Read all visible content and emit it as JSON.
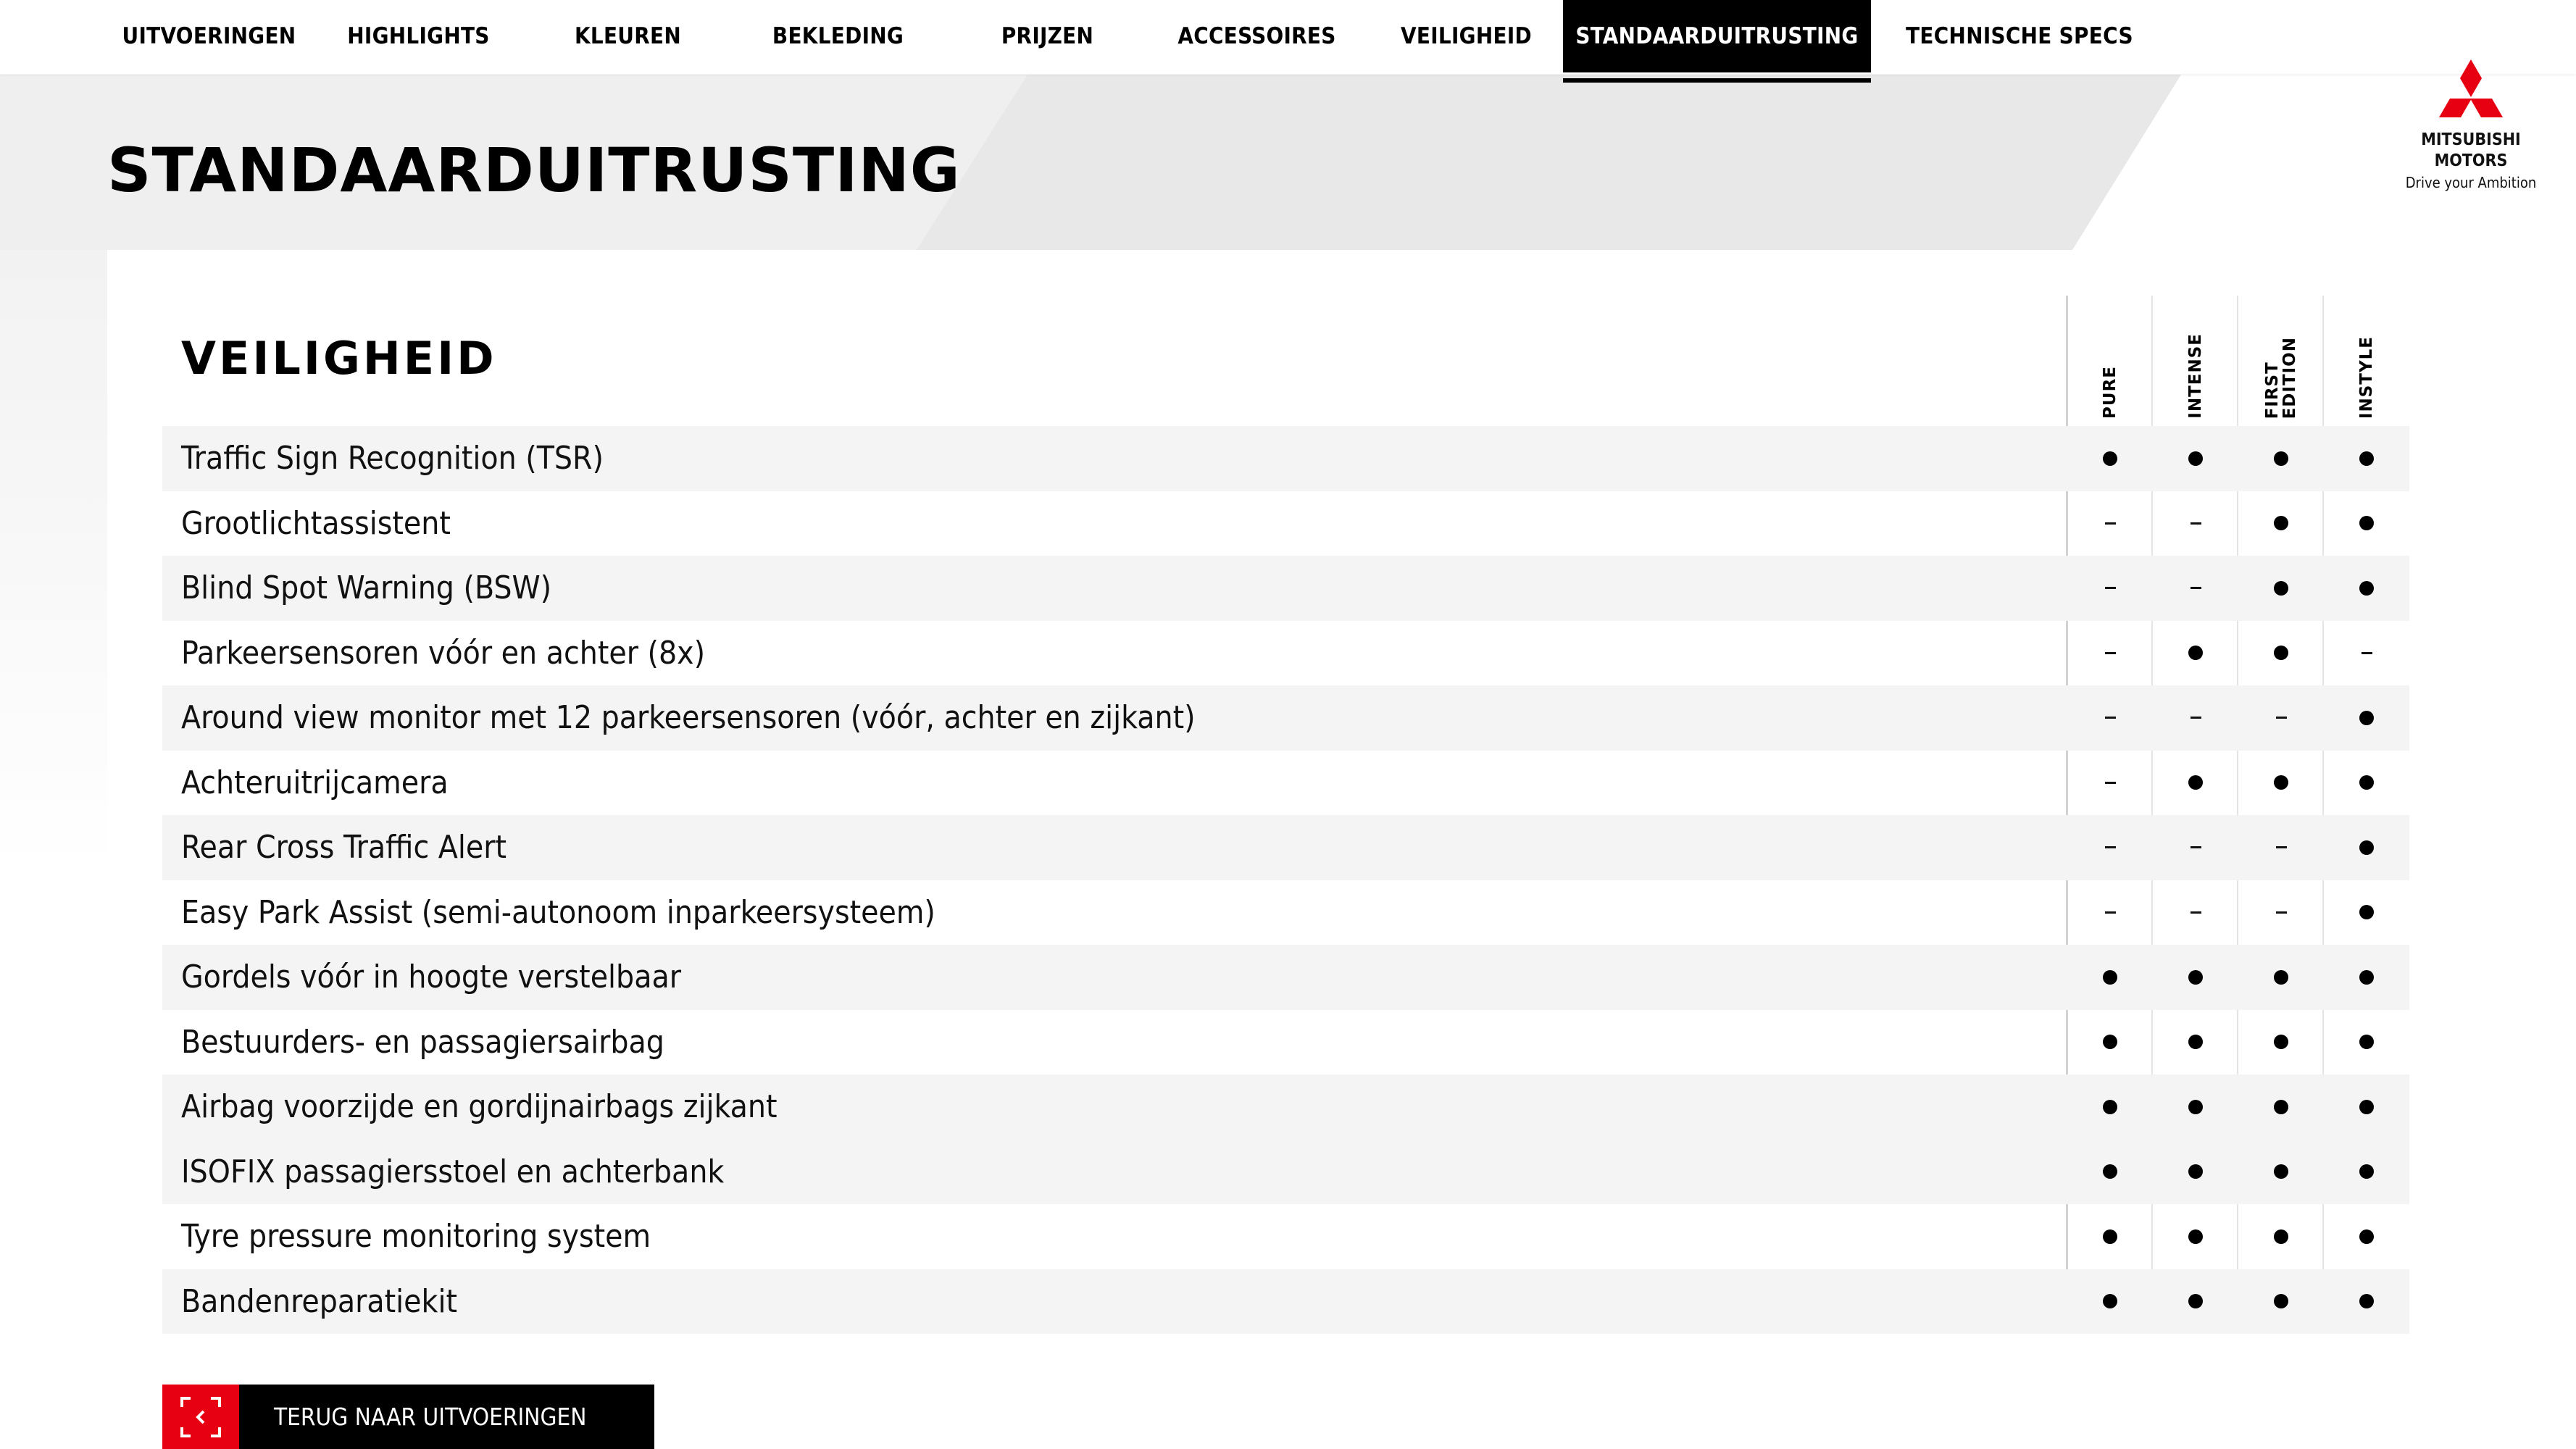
{
  "nav": {
    "items": [
      {
        "label": "UITVOERINGEN",
        "active": false
      },
      {
        "label": "HIGHLIGHTS",
        "active": false
      },
      {
        "label": "KLEUREN",
        "active": false
      },
      {
        "label": "BEKLEDING",
        "active": false
      },
      {
        "label": "PRIJZEN",
        "active": false
      },
      {
        "label": "ACCESSOIRES",
        "active": false
      },
      {
        "label": "VEILIGHEID",
        "active": false
      },
      {
        "label": "STANDAARDUITRUSTING",
        "active": true
      },
      {
        "label": "TECHNISCHE SPECS",
        "active": false
      }
    ]
  },
  "page": {
    "title": "STANDAARDUITRUSTING"
  },
  "brand": {
    "name_line1": "MITSUBISHI",
    "name_line2": "MOTORS",
    "tagline": "Drive your Ambition",
    "logo_color": "#e60012"
  },
  "section": {
    "title": "VEILIGHEID",
    "columns": [
      "PURE",
      "INTENSE",
      "FIRST\nEDITION",
      "INSTYLE"
    ],
    "legend": {
      "included": "dot",
      "not_included": "dash"
    },
    "rows": [
      {
        "label": "Traffic Sign Recognition (TSR)",
        "values": [
          true,
          true,
          true,
          true
        ],
        "shaded": true
      },
      {
        "label": "Grootlichtassistent",
        "values": [
          false,
          false,
          true,
          true
        ],
        "shaded": false
      },
      {
        "label": "Blind Spot Warning (BSW)",
        "values": [
          false,
          false,
          true,
          true
        ],
        "shaded": true
      },
      {
        "label": "Parkeersensoren vóór en achter (8x)",
        "values": [
          false,
          true,
          true,
          false
        ],
        "shaded": false
      },
      {
        "label": "Around view monitor met 12 parkeersensoren (vóór, achter en zijkant)",
        "values": [
          false,
          false,
          false,
          true
        ],
        "shaded": true
      },
      {
        "label": "Achteruitrijcamera",
        "values": [
          false,
          true,
          true,
          true
        ],
        "shaded": false
      },
      {
        "label": "Rear Cross Traffic Alert",
        "values": [
          false,
          false,
          false,
          true
        ],
        "shaded": true
      },
      {
        "label": "Easy Park Assist (semi-autonoom inparkeersysteem)",
        "values": [
          false,
          false,
          false,
          true
        ],
        "shaded": false
      },
      {
        "label": "Gordels vóór in hoogte verstelbaar",
        "values": [
          true,
          true,
          true,
          true
        ],
        "shaded": true
      },
      {
        "label": "Bestuurders- en passagiersairbag",
        "values": [
          true,
          true,
          true,
          true
        ],
        "shaded": false
      },
      {
        "label": "Airbag voorzijde en gordijnairbags zijkant",
        "values": [
          true,
          true,
          true,
          true
        ],
        "shaded": true
      },
      {
        "label": "ISOFIX passagiersstoel en achterbank",
        "values": [
          true,
          true,
          true,
          true
        ],
        "shaded": true
      },
      {
        "label": "Tyre pressure monitoring system",
        "values": [
          true,
          true,
          true,
          true
        ],
        "shaded": false
      },
      {
        "label": "Bandenreparatiekit",
        "values": [
          true,
          true,
          true,
          true
        ],
        "shaded": true
      }
    ]
  },
  "back_button": {
    "label": "TERUG NAAR UITVOERINGEN",
    "icon": "back-chevron-frame-icon",
    "accent": "#e60012"
  }
}
